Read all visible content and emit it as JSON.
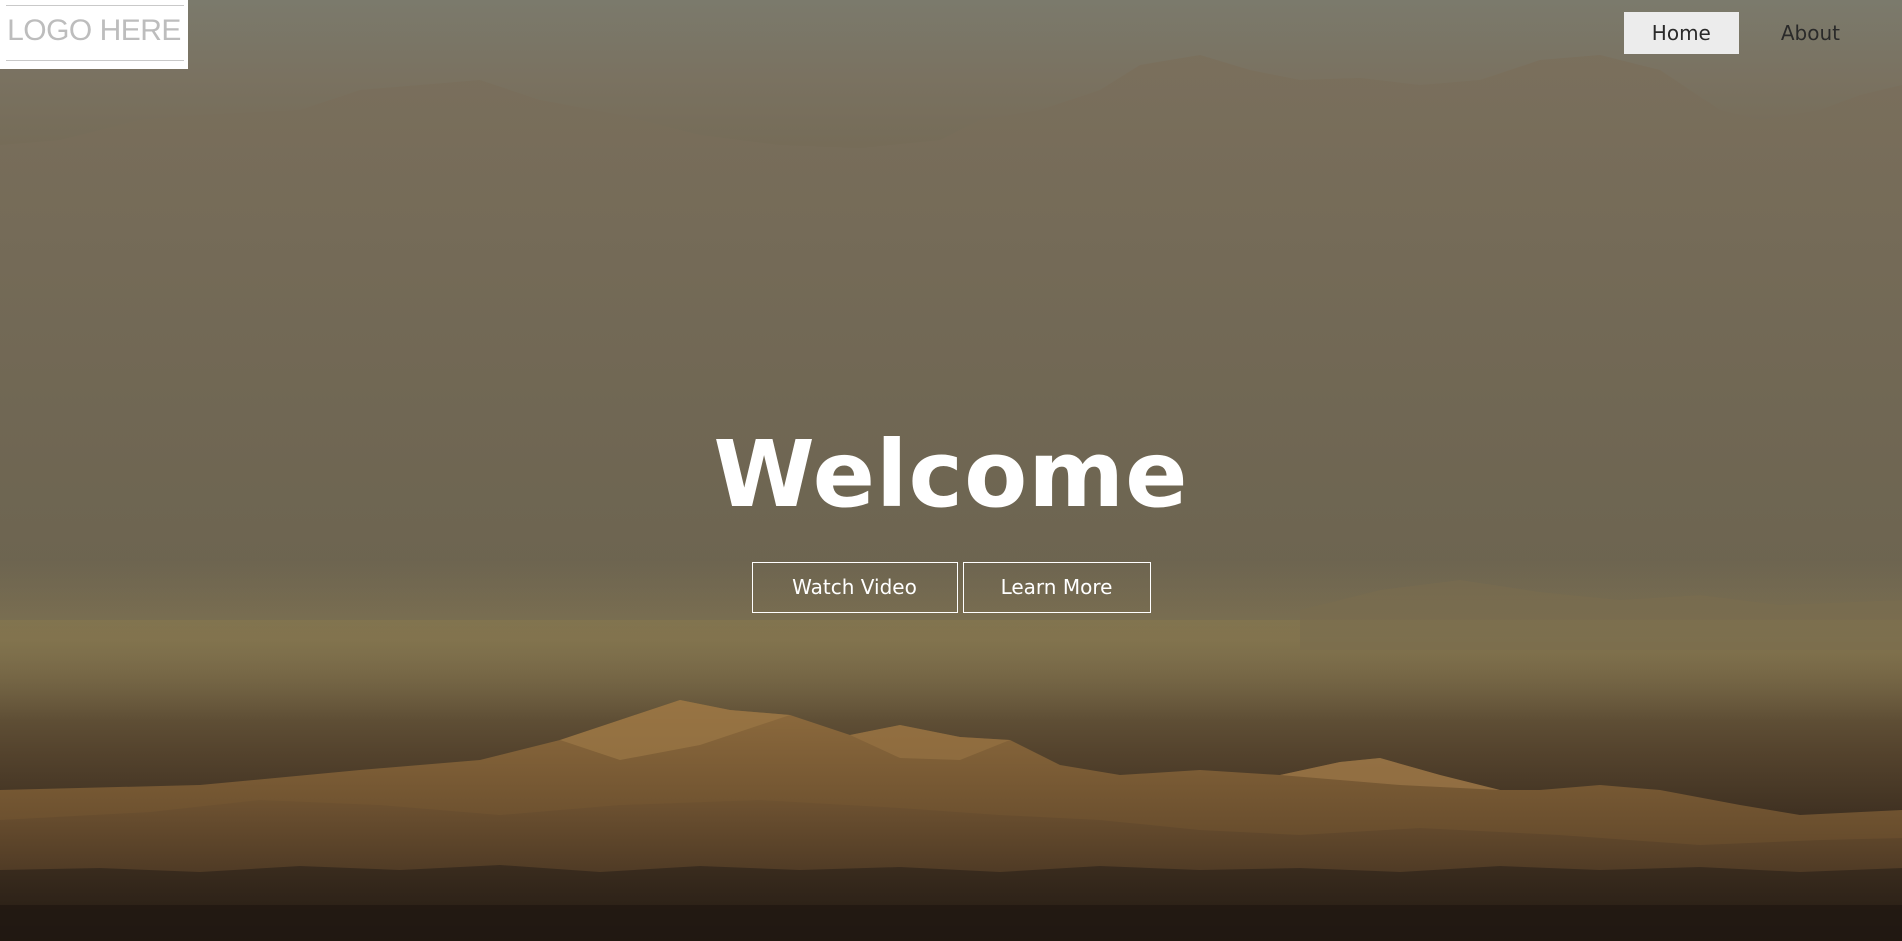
{
  "logo": {
    "text": "LOGO HERE"
  },
  "nav": {
    "items": [
      {
        "label": "Home",
        "active": true
      },
      {
        "label": "About",
        "active": false
      }
    ]
  },
  "hero": {
    "heading": "Welcome",
    "buttons": {
      "watch_label": "Watch Video",
      "learn_label": "Learn More"
    },
    "background": "desert-dunes-mountains-photo"
  },
  "colors": {
    "overlay_top": "#7b7a6c",
    "dune_light": "#8a6a3e",
    "dune_dark": "#3a2a1a",
    "text_light": "#ffffff",
    "nav_active_bg": "#ececec"
  }
}
